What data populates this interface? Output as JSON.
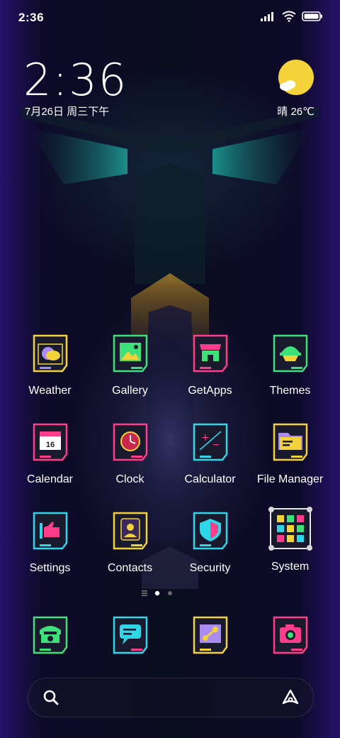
{
  "status_bar": {
    "time": "2:36",
    "signal_icon": "signal-icon",
    "wifi_icon": "wifi-icon",
    "battery_icon": "battery-icon"
  },
  "clock_widget": {
    "time": "2:36",
    "date": "7月26日 周三下午"
  },
  "weather_widget": {
    "icon": "sun-cloud-icon",
    "text": "晴 26℃"
  },
  "apps": [
    {
      "label": "Weather",
      "icon": "weather-icon"
    },
    {
      "label": "Gallery",
      "icon": "gallery-icon"
    },
    {
      "label": "GetApps",
      "icon": "getapps-icon"
    },
    {
      "label": "Themes",
      "icon": "themes-icon"
    },
    {
      "label": "Calendar",
      "icon": "calendar-icon",
      "badge": "16"
    },
    {
      "label": "Clock",
      "icon": "clock-icon"
    },
    {
      "label": "Calculator",
      "icon": "calculator-icon"
    },
    {
      "label": "File Manager",
      "icon": "file-manager-icon"
    },
    {
      "label": "Settings",
      "icon": "settings-icon"
    },
    {
      "label": "Contacts",
      "icon": "contacts-icon"
    },
    {
      "label": "Security",
      "icon": "security-icon"
    },
    {
      "label": "System",
      "icon": "system-folder-icon"
    }
  ],
  "page_indicator": {
    "pages": 2,
    "current": 1
  },
  "dock": [
    {
      "icon": "phone-icon"
    },
    {
      "icon": "messages-icon"
    },
    {
      "icon": "browser-icon"
    },
    {
      "icon": "camera-icon"
    }
  ],
  "search_bar": {
    "left_icon": "search-icon",
    "right_icon": "assistant-icon"
  },
  "colors": {
    "accent_yellow": "#f2d23a",
    "neon_cyan": "#2fd6e8",
    "neon_pink": "#ff3d8a",
    "neon_green": "#3ee07a",
    "bg": "#0a0c1f"
  }
}
